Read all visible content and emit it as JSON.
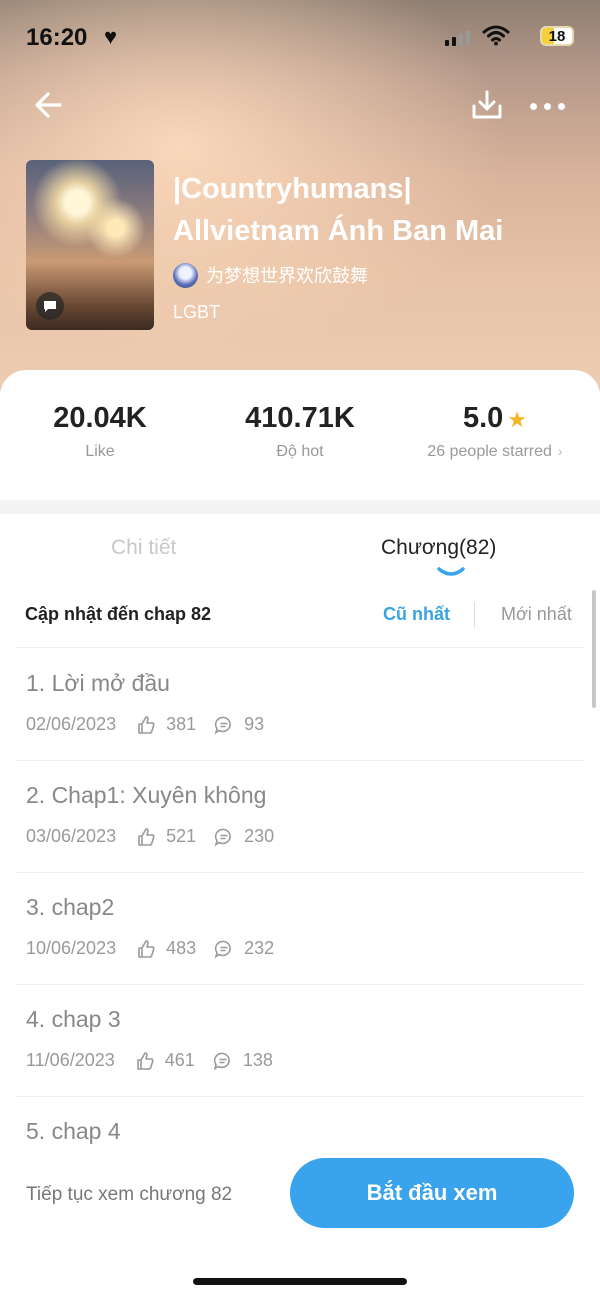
{
  "status_bar": {
    "time": "16:20",
    "battery": "18"
  },
  "book": {
    "title_line1": "|Countryhumans|",
    "title_line2": "Allvietnam Ánh Ban Mai",
    "author": "为梦想世界欢欣鼓舞",
    "genre": "LGBT"
  },
  "stats": {
    "likes": "20.04K",
    "likes_label": "Like",
    "hot": "410.71K",
    "hot_label": "Độ hot",
    "rating": "5.0",
    "rating_label": "26 people starred"
  },
  "tabs": {
    "detail": "Chi tiết",
    "chapters": "Chương(82)"
  },
  "chapter_list": {
    "update_text": "Cập nhật đến chap 82",
    "sort_old": "Cũ nhất",
    "sort_new": "Mới nhất",
    "items": [
      {
        "title": "1. Lời mở đầu",
        "date": "02/06/2023",
        "likes": "381",
        "comments": "93"
      },
      {
        "title": "2. Chap1: Xuyên không",
        "date": "03/06/2023",
        "likes": "521",
        "comments": "230"
      },
      {
        "title": "3. chap2",
        "date": "10/06/2023",
        "likes": "483",
        "comments": "232"
      },
      {
        "title": "4. chap 3",
        "date": "11/06/2023",
        "likes": "461",
        "comments": "138"
      },
      {
        "title": "5. chap 4"
      }
    ]
  },
  "bottom_bar": {
    "continue_text": "Tiếp tục xem chương 82",
    "start_button": "Bắt đầu xem"
  },
  "colors": {
    "accent": "#39a3ee",
    "star": "#f5b623"
  },
  "icons": [
    "back-arrow-icon",
    "download-icon",
    "more-icon",
    "comment-icon",
    "thumbs-up-icon",
    "chevron-right-icon",
    "star-icon"
  ]
}
